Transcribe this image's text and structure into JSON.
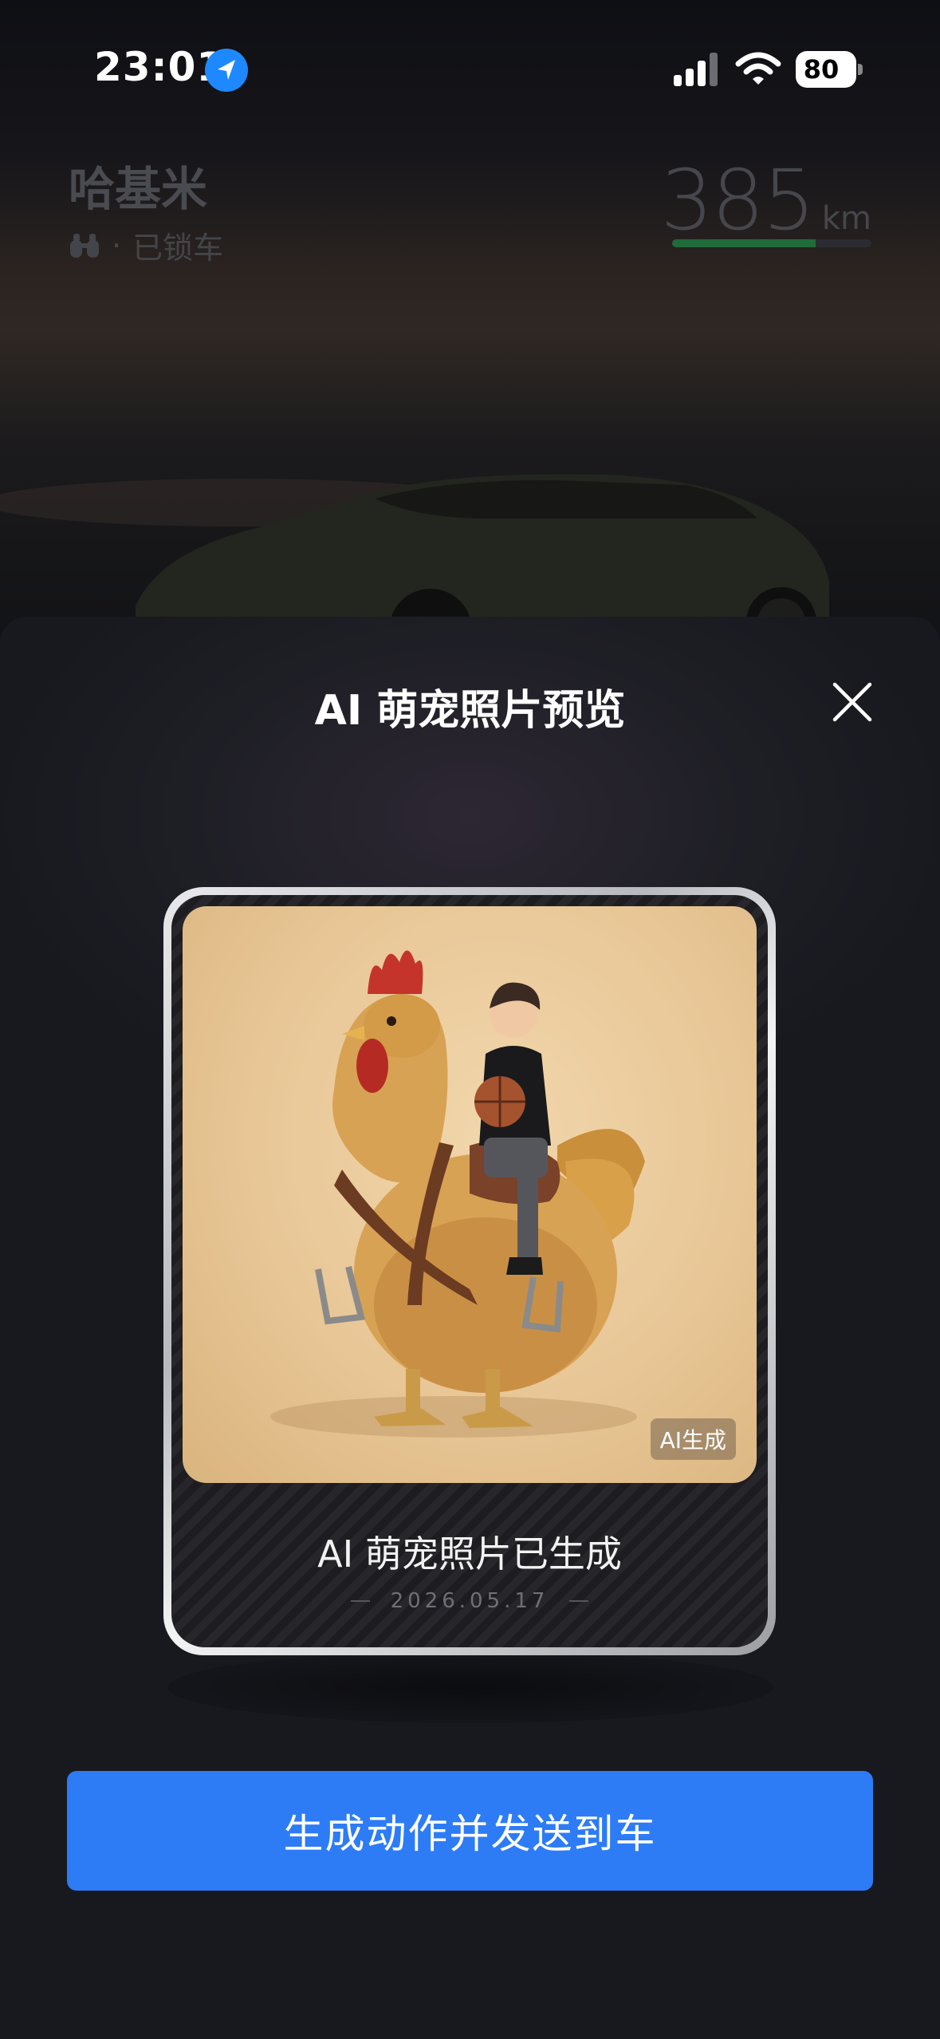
{
  "status_bar": {
    "time": "23:01",
    "battery_percent": "80",
    "location_icon": "location-arrow-icon",
    "signal_icon": "cellular-signal-icon",
    "wifi_icon": "wifi-icon",
    "battery_icon": "battery-charging-icon"
  },
  "vehicle": {
    "name": "哈基米",
    "lock_status": "已锁车",
    "separator": "·",
    "range_value": "385",
    "range_unit": "km",
    "range_fill_fraction": 0.72
  },
  "modal": {
    "title": "AI 萌宠照片预览",
    "close_icon": "close-icon",
    "card": {
      "badge": "AI生成",
      "caption": "AI 萌宠照片已生成",
      "date": "2026.05.17"
    },
    "primary_button": "生成动作并发送到车"
  },
  "colors": {
    "accent_blue": "#2d7cf6",
    "location_blue": "#1e88ff",
    "range_green": "#1f6b3a",
    "sheet_bg": "#1a1b20"
  }
}
